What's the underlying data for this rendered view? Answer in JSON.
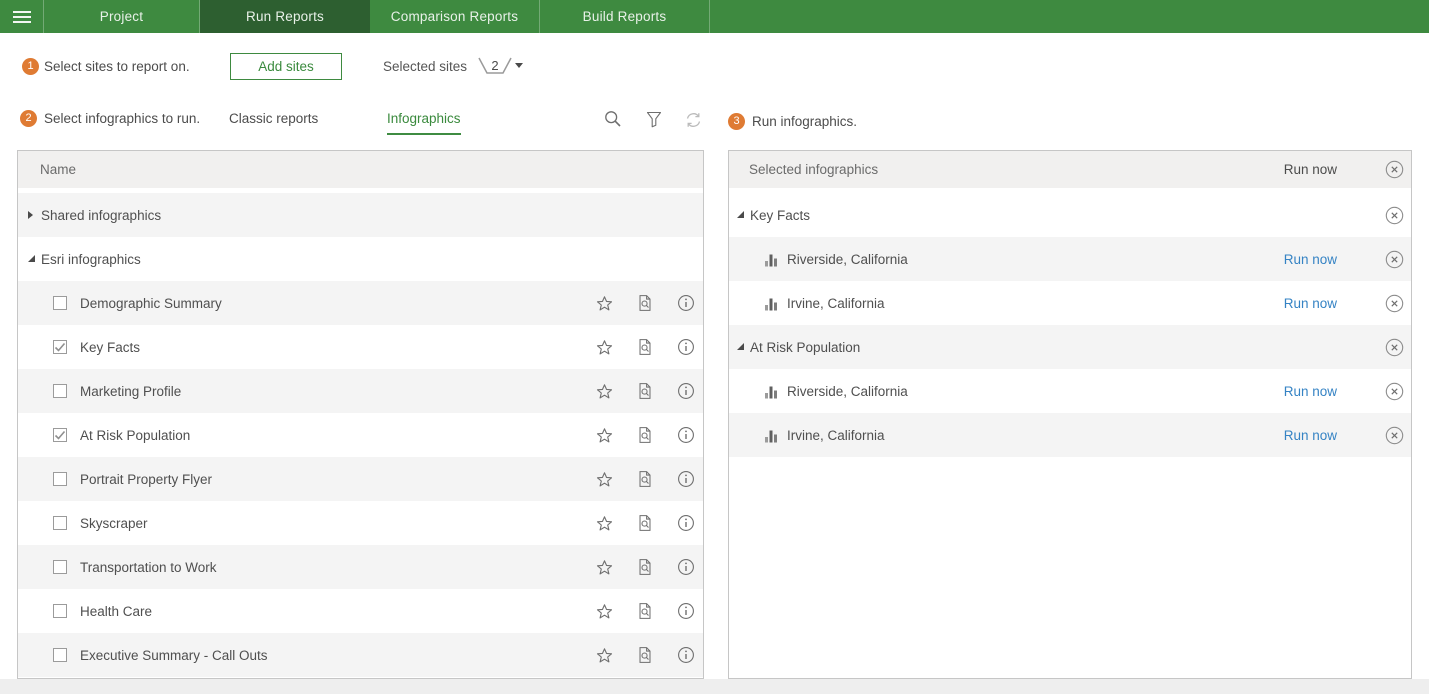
{
  "nav": {
    "tabs": [
      {
        "label": "Project",
        "active": false
      },
      {
        "label": "Run Reports",
        "active": true
      },
      {
        "label": "Comparison Reports",
        "active": false
      },
      {
        "label": "Build Reports",
        "active": false
      }
    ]
  },
  "step1": {
    "number": "1",
    "label": "Select sites to report on.",
    "add_sites_button": "Add sites",
    "selected_sites_label": "Selected sites",
    "selected_sites_count": "2"
  },
  "step2": {
    "number": "2",
    "label": "Select infographics to run.",
    "tabs": [
      {
        "label": "Classic reports",
        "active": false
      },
      {
        "label": "Infographics",
        "active": true
      }
    ]
  },
  "step3": {
    "number": "3",
    "label": "Run infographics."
  },
  "infographics_table": {
    "name_header": "Name",
    "rows": [
      {
        "type": "group",
        "label": "Shared infographics",
        "expanded": false
      },
      {
        "type": "group",
        "label": "Esri infographics",
        "expanded": true
      },
      {
        "type": "item",
        "label": "Demographic Summary",
        "checked": false
      },
      {
        "type": "item",
        "label": "Key Facts",
        "checked": true
      },
      {
        "type": "item",
        "label": "Marketing Profile",
        "checked": false
      },
      {
        "type": "item",
        "label": "At Risk Population",
        "checked": true
      },
      {
        "type": "item",
        "label": "Portrait Property Flyer",
        "checked": false
      },
      {
        "type": "item",
        "label": "Skyscraper",
        "checked": false
      },
      {
        "type": "item",
        "label": "Transportation to Work",
        "checked": false
      },
      {
        "type": "item",
        "label": "Health Care",
        "checked": false
      },
      {
        "type": "item",
        "label": "Executive Summary - Call Outs",
        "checked": false
      }
    ]
  },
  "selected_panel": {
    "header": "Selected infographics",
    "header_run_label": "Run now",
    "rows": [
      {
        "type": "group",
        "label": "Key Facts",
        "expanded": true
      },
      {
        "type": "site",
        "label": "Riverside, California",
        "run_label": "Run now"
      },
      {
        "type": "site",
        "label": "Irvine, California",
        "run_label": "Run now"
      },
      {
        "type": "group",
        "label": "At Risk Population",
        "expanded": true
      },
      {
        "type": "site",
        "label": "Riverside, California",
        "run_label": "Run now"
      },
      {
        "type": "site",
        "label": "Irvine, California",
        "run_label": "Run now"
      }
    ]
  },
  "colors": {
    "nav_green": "#3e8a40",
    "nav_active_green": "#2d5f30",
    "accent_green": "#3a8a3d",
    "step_orange": "#df7b33",
    "link_blue": "#3583c4",
    "text_gray": "#4c4c4c"
  }
}
